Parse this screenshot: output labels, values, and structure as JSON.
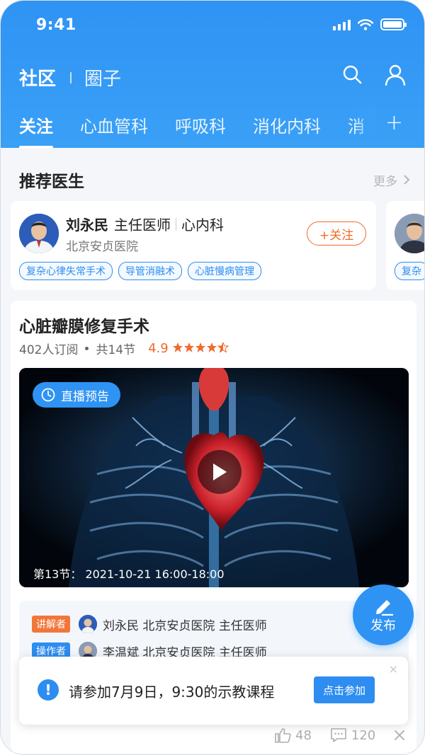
{
  "status_bar": {
    "time": "9:41"
  },
  "header": {
    "title_active": "社区",
    "title_inactive": "圈子",
    "tabs": [
      {
        "label": "关注",
        "active": true
      },
      {
        "label": "心血管科"
      },
      {
        "label": "呼吸科"
      },
      {
        "label": "消化内科"
      },
      {
        "label": "消"
      }
    ],
    "add_tab_symbol": "+"
  },
  "recommend": {
    "title": "推荐医生",
    "more_label": "更多",
    "doctor": {
      "name": "刘永民",
      "title": "主任医师",
      "department": "心内科",
      "hospital": "北京安贞医院",
      "follow_label": "+关注",
      "tags": [
        "复杂心律失常手术",
        "导管消融术",
        "心脏慢病管理"
      ]
    },
    "next_card_tag": "复杂"
  },
  "course": {
    "title": "心脏瓣膜修复手术",
    "subscribers": "402人订阅",
    "lessons": "共14节",
    "rating": "4.9",
    "rating_stars": 4.5,
    "live_badge": "直播预告",
    "schedule": "第13节：  2021-10-21    16:00-18:00",
    "presenters": [
      {
        "role": "讲解者",
        "role_color": "#f2763a",
        "name": "刘永民",
        "hospital": "北京安贞医院",
        "title": "主任医师"
      },
      {
        "role": "操作者",
        "role_color": "#2d8df0",
        "name": "李温斌",
        "hospital": "北京安贞医院",
        "title": "主任医师"
      }
    ],
    "likes": "48",
    "comments": "120"
  },
  "fab": {
    "label": "发布"
  },
  "toast": {
    "message": "请参加7月9日，9:30的示教课程",
    "button": "点击参加",
    "close": "×"
  },
  "colors": {
    "brand": "#2f93f4",
    "accent_orange": "#f06a2a"
  }
}
